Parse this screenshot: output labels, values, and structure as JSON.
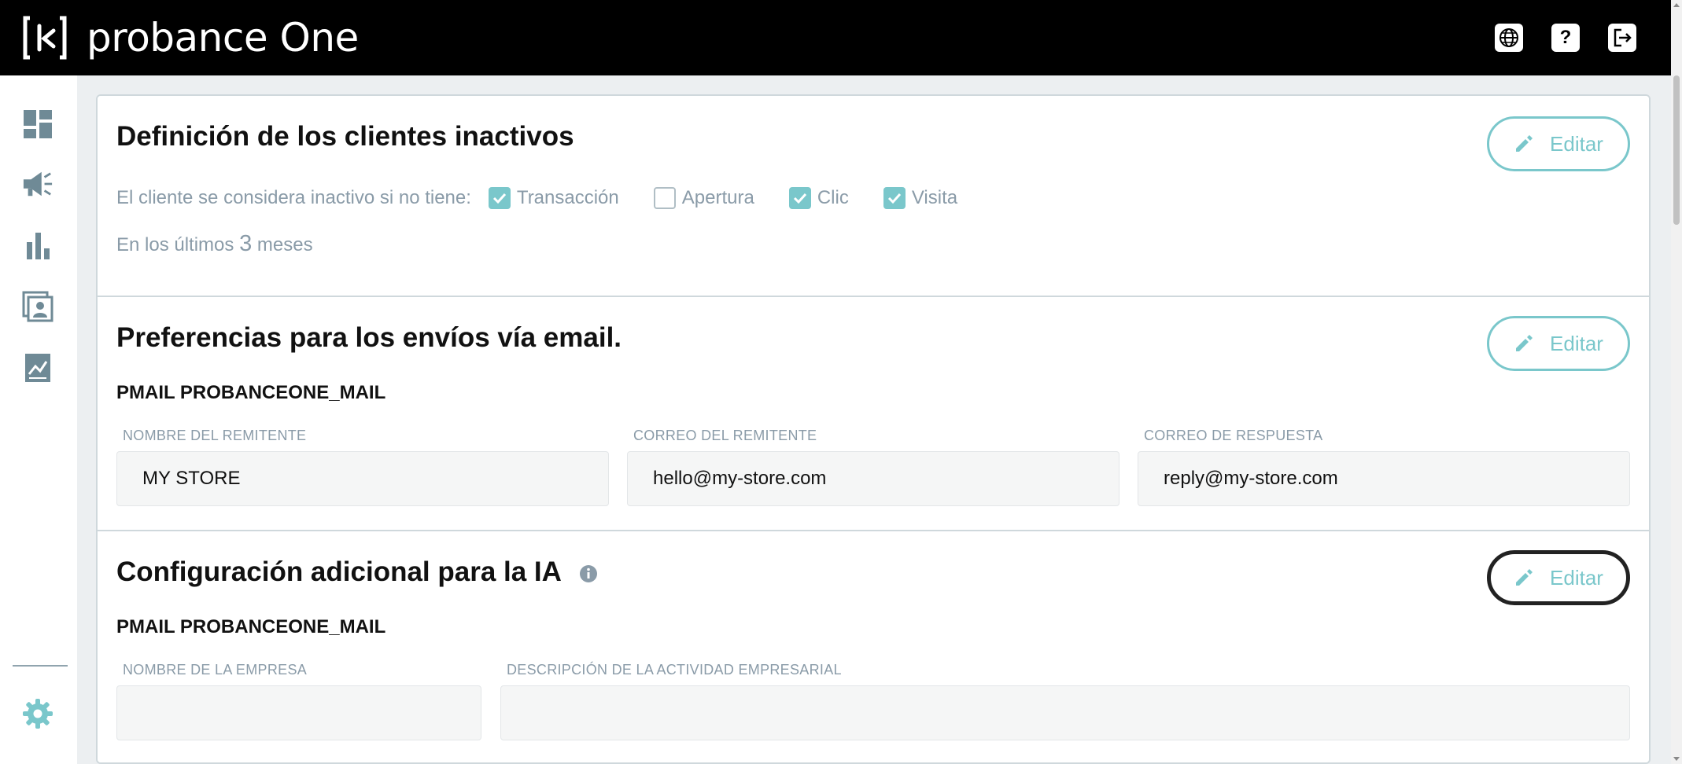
{
  "header": {
    "brand": "probance One",
    "actions": [
      {
        "icon": "globe-icon"
      },
      {
        "icon": "help-icon",
        "glyph": "?"
      },
      {
        "icon": "logout-icon"
      }
    ]
  },
  "sidebar": {
    "items": [
      {
        "icon": "dashboard-icon"
      },
      {
        "icon": "megaphone-icon"
      },
      {
        "icon": "bar-chart-icon"
      },
      {
        "icon": "contacts-icon"
      },
      {
        "icon": "report-icon"
      }
    ],
    "settings_icon": "settings-gear-icon"
  },
  "colors": {
    "accent": "#7ac7cb",
    "muted": "#8a9ba8",
    "topbar": "#000000"
  },
  "sections": {
    "inactive": {
      "title": "Definición de los clientes inactivos",
      "edit_label": "Editar",
      "criteria_label": "El cliente se considera inactivo si no tiene:",
      "criteria": [
        {
          "label": "Transacción",
          "checked": true
        },
        {
          "label": "Apertura",
          "checked": false
        },
        {
          "label": "Clic",
          "checked": true
        },
        {
          "label": "Visita",
          "checked": true
        }
      ],
      "period_prefix": "En los últimos",
      "period_value": "3",
      "period_suffix": "meses"
    },
    "email": {
      "title": "Preferencias para los envíos vía email.",
      "edit_label": "Editar",
      "subtitle": "PMAIL PROBANCEONE_MAIL",
      "fields": [
        {
          "label": "NOMBRE DEL REMITENTE",
          "value": "MY STORE"
        },
        {
          "label": "CORREO DEL REMITENTE",
          "value": "hello@my-store.com"
        },
        {
          "label": "CORREO DE RESPUESTA",
          "value": "reply@my-store.com"
        }
      ]
    },
    "ai": {
      "title": "Configuración adicional para la IA",
      "edit_label": "Editar",
      "subtitle": "PMAIL PROBANCEONE_MAIL",
      "fields": [
        {
          "label": "NOMBRE DE LA EMPRESA",
          "value": ""
        },
        {
          "label": "DESCRIPCIÓN DE LA ACTIVIDAD EMPRESARIAL",
          "value": ""
        }
      ]
    }
  }
}
